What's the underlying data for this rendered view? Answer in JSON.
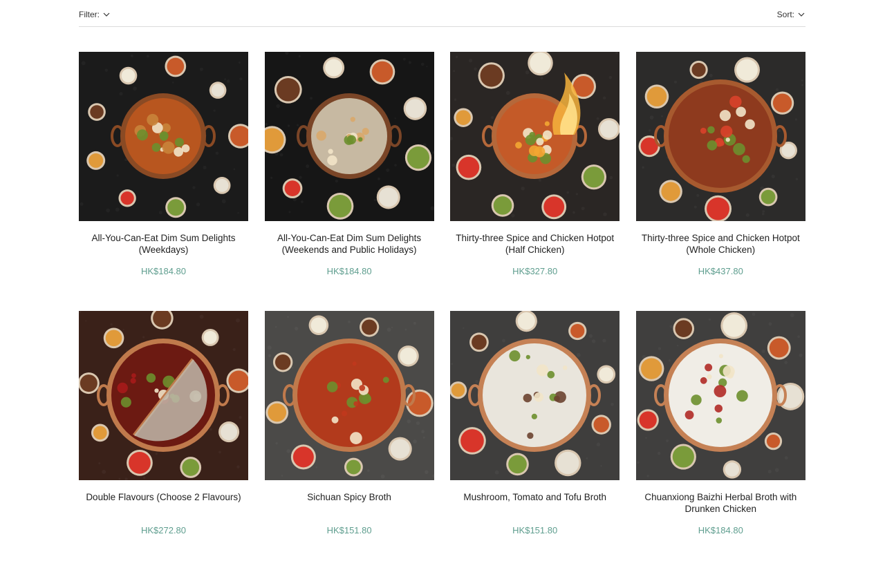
{
  "toolbar": {
    "filter_label": "Filter:",
    "sort_label": "Sort:"
  },
  "products": [
    {
      "title": "All-You-Can-Eat Dim Sum Delights (Weekdays)",
      "price": "HK$184.80",
      "image": "dim-sum-spread-photo",
      "colors": {
        "bg": "#1b1b1b",
        "pot": "#8a4a24",
        "accent": "#c9843a",
        "broth": "#b8561f"
      }
    },
    {
      "title": "All-You-Can-Eat Dim Sum Delights (Weekends and Public Holidays)",
      "price": "HK$184.80",
      "image": "dim-sum-platter-photo",
      "colors": {
        "bg": "#161616",
        "pot": "#7a4527",
        "accent": "#d9a86a",
        "broth": "#c7b9a2"
      }
    },
    {
      "title": "Thirty-three Spice and Chicken Hotpot (Half Chicken)",
      "price": "HK$327.80",
      "image": "flaming-copper-hotpot-photo",
      "colors": {
        "bg": "#2a2624",
        "pot": "#b5683a",
        "accent": "#f3a632",
        "broth": "#c45a28"
      }
    },
    {
      "title": "Thirty-three Spice and Chicken Hotpot (Whole Chicken)",
      "price": "HK$437.80",
      "image": "chicken-hotpot-topdown-photo",
      "colors": {
        "bg": "#2c2b2a",
        "pot": "#a75a2f",
        "accent": "#d9432a",
        "broth": "#8e3a1e"
      }
    },
    {
      "title": "Double Flavours (Choose 2 Flavours)",
      "price": "HK$272.80",
      "image": "split-broth-hotpot-photo",
      "colors": {
        "bg": "#3a2119",
        "pot": "#c07a4c",
        "accent": "#a71b1b",
        "broth": "#6c1a12"
      }
    },
    {
      "title": "Sichuan Spicy Broth",
      "price": "HK$151.80",
      "image": "sichuan-spicy-broth-photo",
      "colors": {
        "bg": "#4b4a48",
        "pot": "#c07a4c",
        "accent": "#c0391d",
        "broth": "#b23a1c"
      }
    },
    {
      "title": "Mushroom, Tomato and Tofu Broth",
      "price": "HK$151.80",
      "image": "mushroom-tofu-broth-photo",
      "colors": {
        "bg": "#3f3e3d",
        "pot": "#c58155",
        "accent": "#6b4330",
        "broth": "#e9e5dc"
      }
    },
    {
      "title": "Chuanxiong Baizhi Herbal Broth with Drunken Chicken",
      "price": "HK$184.80",
      "image": "herbal-broth-photo",
      "colors": {
        "bg": "#403f3e",
        "pot": "#c58155",
        "accent": "#b02a26",
        "broth": "#f0ede6"
      }
    }
  ]
}
